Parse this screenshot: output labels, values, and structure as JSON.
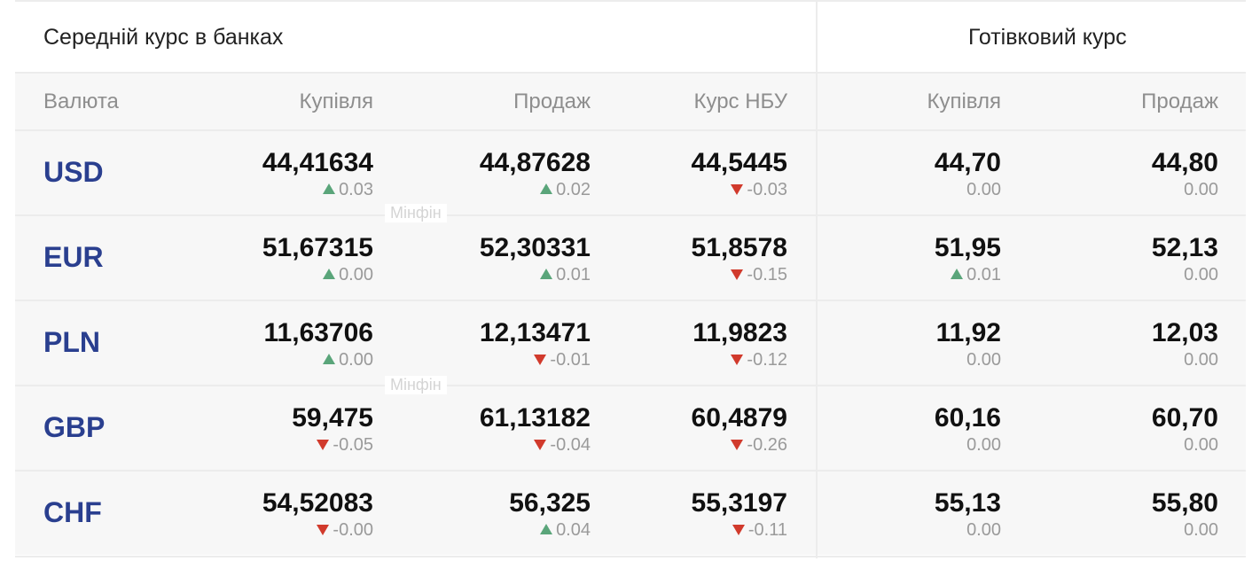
{
  "headers": {
    "banks_group": "Середній курс в банках",
    "cash_group": "Готівковий курс",
    "col_currency": "Валюта",
    "col_buy": "Купівля",
    "col_sell": "Продаж",
    "col_nbu": "Курс НБУ",
    "col_cash_buy": "Купівля",
    "col_cash_sell": "Продаж"
  },
  "watermark": "Мінфін",
  "colors": {
    "up": "#5aa57a",
    "down": "#d13a2c",
    "currency": "#2a3f8f"
  },
  "rows": [
    {
      "code": "USD",
      "buy": {
        "value": "44,41634",
        "change": "0.03",
        "dir": "up"
      },
      "sell": {
        "value": "44,87628",
        "change": "0.02",
        "dir": "up"
      },
      "nbu": {
        "value": "44,5445",
        "change": "-0.03",
        "dir": "down"
      },
      "cash_buy": {
        "value": "44,70",
        "change": "0.00",
        "dir": "none"
      },
      "cash_sell": {
        "value": "44,80",
        "change": "0.00",
        "dir": "none"
      }
    },
    {
      "code": "EUR",
      "buy": {
        "value": "51,67315",
        "change": "0.00",
        "dir": "up"
      },
      "sell": {
        "value": "52,30331",
        "change": "0.01",
        "dir": "up"
      },
      "nbu": {
        "value": "51,8578",
        "change": "-0.15",
        "dir": "down"
      },
      "cash_buy": {
        "value": "51,95",
        "change": "0.01",
        "dir": "up"
      },
      "cash_sell": {
        "value": "52,13",
        "change": "0.00",
        "dir": "none"
      }
    },
    {
      "code": "PLN",
      "buy": {
        "value": "11,63706",
        "change": "0.00",
        "dir": "up"
      },
      "sell": {
        "value": "12,13471",
        "change": "-0.01",
        "dir": "down"
      },
      "nbu": {
        "value": "11,9823",
        "change": "-0.12",
        "dir": "down"
      },
      "cash_buy": {
        "value": "11,92",
        "change": "0.00",
        "dir": "none"
      },
      "cash_sell": {
        "value": "12,03",
        "change": "0.00",
        "dir": "none"
      }
    },
    {
      "code": "GBP",
      "buy": {
        "value": "59,475",
        "change": "-0.05",
        "dir": "down"
      },
      "sell": {
        "value": "61,13182",
        "change": "-0.04",
        "dir": "down"
      },
      "nbu": {
        "value": "60,4879",
        "change": "-0.26",
        "dir": "down"
      },
      "cash_buy": {
        "value": "60,16",
        "change": "0.00",
        "dir": "none"
      },
      "cash_sell": {
        "value": "60,70",
        "change": "0.00",
        "dir": "none"
      }
    },
    {
      "code": "CHF",
      "buy": {
        "value": "54,52083",
        "change": "-0.00",
        "dir": "down"
      },
      "sell": {
        "value": "56,325",
        "change": "0.04",
        "dir": "up"
      },
      "nbu": {
        "value": "55,3197",
        "change": "-0.11",
        "dir": "down"
      },
      "cash_buy": {
        "value": "55,13",
        "change": "0.00",
        "dir": "none"
      },
      "cash_sell": {
        "value": "55,80",
        "change": "0.00",
        "dir": "none"
      }
    }
  ]
}
